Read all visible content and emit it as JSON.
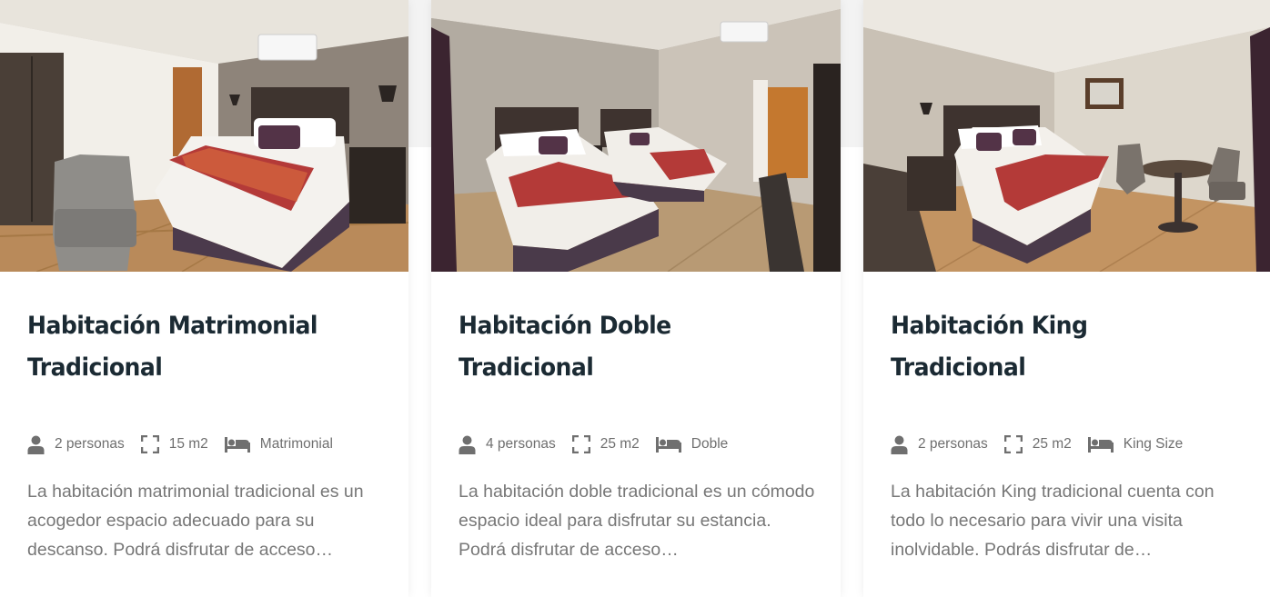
{
  "rooms": [
    {
      "title": "Habitación Matrimonial Tradicional",
      "persons": "2 personas",
      "size": "15 m2",
      "bed": "Matrimonial",
      "description": "La habitación matrimonial tradicional es un acogedor espacio adecuado para su descanso. Podrá disfrutar de acceso…"
    },
    {
      "title": "Habitación Doble Tradicional",
      "persons": "4 personas",
      "size": "25 m2",
      "bed": "Doble",
      "description": "La habitación doble tradicional es un cómodo espacio ideal para disfrutar su estancia. Podrá disfrutar de acceso…"
    },
    {
      "title": "Habitación King Tradicional",
      "persons": "2 personas",
      "size": "25 m2",
      "bed": "King Size",
      "description": "La habitación King tradicional cuenta con todo lo necesario para vivir una visita inolvidable. Podrás disfrutar de…"
    }
  ],
  "icons": {
    "persons": "person-icon",
    "size": "expand-icon",
    "bed": "bed-icon"
  },
  "colors": {
    "title": "#1b2a33",
    "text": "#777777",
    "icon": "#6f6f6f"
  }
}
